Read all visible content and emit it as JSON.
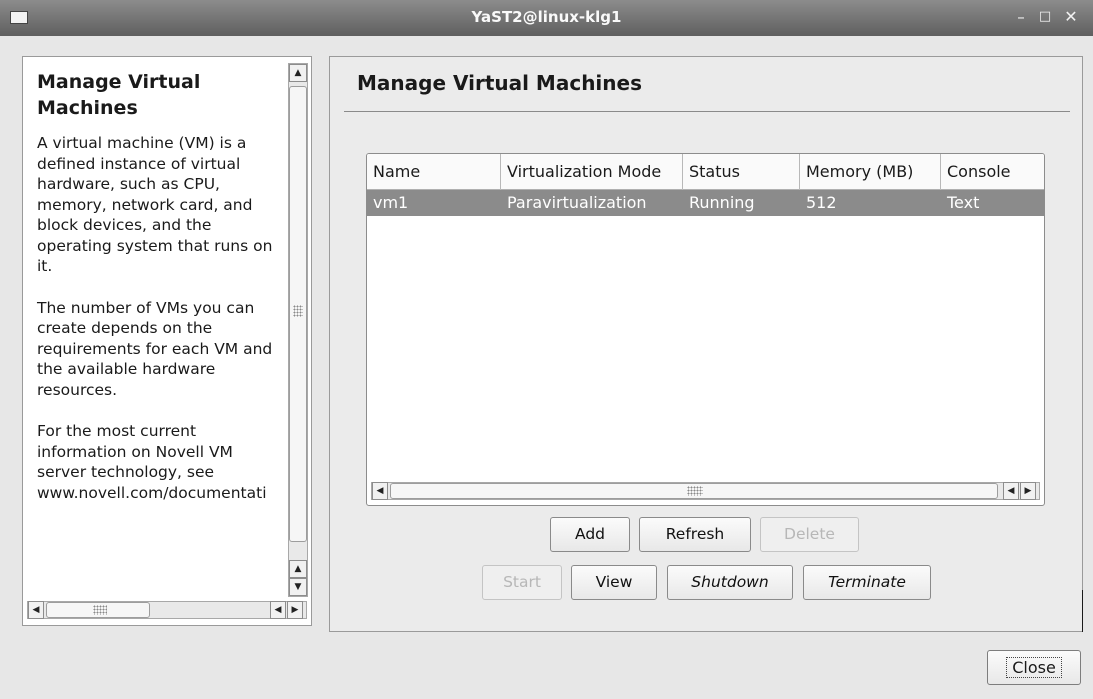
{
  "window": {
    "title": "YaST2@linux-klg1",
    "controls": {
      "minimize": "–",
      "maximize": "□",
      "close": "✕"
    }
  },
  "help": {
    "title": "Manage Virtual Machines",
    "paragraphs": [
      "A virtual machine (VM) is a defined instance of virtual hardware, such as CPU, memory, network card, and block devices, and the operating system that runs on it.",
      "The number of VMs you can create depends on the requirements for each VM and the available hardware resources.",
      "For the most current information on Novell VM server technology, see www.novell.com/documentati"
    ]
  },
  "main": {
    "title": "Manage Virtual Machines",
    "table": {
      "columns": [
        "Name",
        "Virtualization Mode",
        "Status",
        "Memory (MB)",
        "Console"
      ],
      "rows": [
        [
          "vm1",
          "Paravirtualization",
          "Running",
          "512",
          "Text"
        ]
      ],
      "selected_row": 0
    },
    "buttons": {
      "add": "Add",
      "refresh": "Refresh",
      "delete": "Delete",
      "start": "Start",
      "view": "View",
      "shutdown": "Shutdown",
      "terminate": "Terminate"
    },
    "disabled_buttons": [
      "delete",
      "start"
    ]
  },
  "footer": {
    "close_label": "Close"
  },
  "icons": {
    "scroll_up": "▲",
    "scroll_down": "▼",
    "scroll_left": "◀",
    "scroll_right": "▶"
  },
  "colors": {
    "titlebar": "#6f6f6f",
    "selected_row": "#8b8b8b",
    "background": "#e7e7e7"
  }
}
